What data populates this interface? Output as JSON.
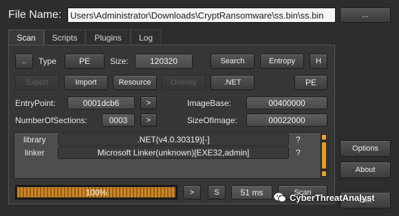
{
  "header": {
    "file_name_label": "File Name:",
    "file_path": "Users\\Administrator\\Downloads\\CryptRansomware\\ss.bin\\ss.bin",
    "browse_label": "..."
  },
  "tabs": [
    "Scan",
    "Scripts",
    "Plugins",
    "Log"
  ],
  "row1": {
    "dots_label": "..",
    "type_label": "Type",
    "type_value": "PE",
    "size_label": "Size:",
    "size_value": "120320",
    "search_label": "Search",
    "entropy_label": "Entropy",
    "h_label": "H"
  },
  "row2": {
    "export_label": "Export",
    "import_label": "Import",
    "resource_label": "Resource",
    "overlay_label": "Overlay",
    "net_label": ".NET",
    "pe_label": "PE"
  },
  "row3": {
    "entrypoint_label": "EntryPoint:",
    "entrypoint_value": "0001dcb6",
    "arrow_label": ">",
    "imagebase_label": "ImageBase:",
    "imagebase_value": "00400000"
  },
  "row4": {
    "sections_label": "NumberOfSections:",
    "sections_value": "0003",
    "arrow_label": ">",
    "sizeofimage_label": "SizeOfImage:",
    "sizeofimage_value": "00022000"
  },
  "detections": [
    {
      "type": "library",
      "value": ".NET(v4.0.30319)[-]",
      "q": "?"
    },
    {
      "type": "linker",
      "value": "Microsoft Linker(unknown)[EXE32,admin]",
      "q": "?"
    }
  ],
  "bottom": {
    "progress_label": "100%",
    "progress_fraction": 1.0,
    "arrow_label": ">",
    "s_label": "S",
    "time_label": "51 ms",
    "scan_label": "Scan"
  },
  "side": {
    "options_label": "Options",
    "about_label": "About",
    "exit_label": "Exit"
  },
  "watermark": "CyberThreatAnalyst"
}
